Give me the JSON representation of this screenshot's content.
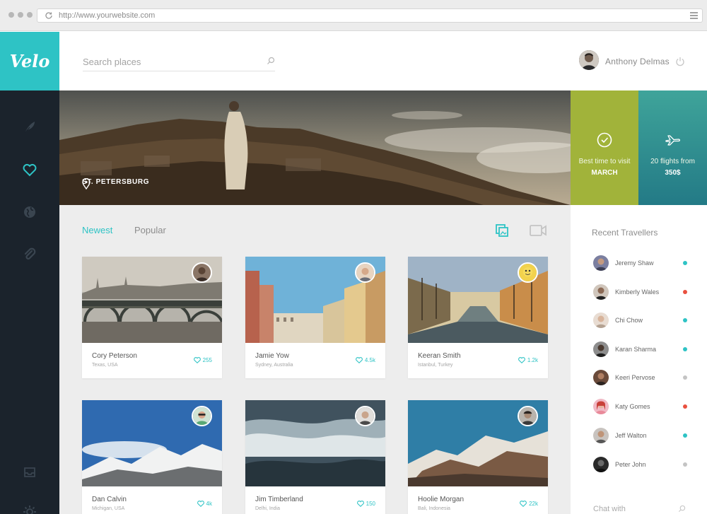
{
  "browser": {
    "url": "http://www.yourwebsite.com"
  },
  "app": {
    "logo": "Velo"
  },
  "sidebar": {
    "icons": [
      "feather-icon",
      "heart-icon",
      "globe-icon",
      "paperclip-icon",
      "inbox-icon",
      "settings-icon"
    ],
    "active": "heart-icon"
  },
  "header": {
    "search_placeholder": "Search places",
    "user_name": "Anthony Delmas"
  },
  "hero": {
    "location": "ST. PETERSBURG"
  },
  "stats": {
    "visit": {
      "label": "Best time to visit",
      "value": "MARCH"
    },
    "flights": {
      "label": "20 flights from",
      "value": "350$"
    }
  },
  "tabs": {
    "newest": "Newest",
    "popular": "Popular",
    "active": "Newest"
  },
  "cards": [
    {
      "name": "Cory Peterson",
      "place": "Texas, USA",
      "likes": "255"
    },
    {
      "name": "Jamie Yow",
      "place": "Sydney, Australia",
      "likes": "4.5k"
    },
    {
      "name": "Keeran Smith",
      "place": "Istanbul, Turkey",
      "likes": "1.2k"
    },
    {
      "name": "Dan Calvin",
      "place": "Michigan, USA",
      "likes": "4k"
    },
    {
      "name": "Jim Timberland",
      "place": "Delhi, India",
      "likes": "150"
    },
    {
      "name": "Hoolie Morgan",
      "place": "Bali, Indonesia",
      "likes": "22k"
    }
  ],
  "recent": {
    "title": "Recent Travellers",
    "items": [
      {
        "name": "Jeremy Shaw",
        "status_color": "#2ec3c5"
      },
      {
        "name": "Kimberly Wales",
        "status_color": "#e9503f"
      },
      {
        "name": "Chi Chow",
        "status_color": "#2ec3c5"
      },
      {
        "name": "Karan Sharma",
        "status_color": "#2ec3c5"
      },
      {
        "name": "Keeri Pervose",
        "status_color": "#c4c4c4"
      },
      {
        "name": "Katy Gomes",
        "status_color": "#e9503f"
      },
      {
        "name": "Jeff Walton",
        "status_color": "#2ec3c5"
      },
      {
        "name": "Peter John",
        "status_color": "#c4c4c4"
      }
    ]
  },
  "chat": {
    "label": "Chat with"
  },
  "colors": {
    "accent": "#2ec3c5",
    "sidebar": "#1b232c",
    "visit_tile": "#a1b33a",
    "flights_tile": "#2e8f90"
  }
}
